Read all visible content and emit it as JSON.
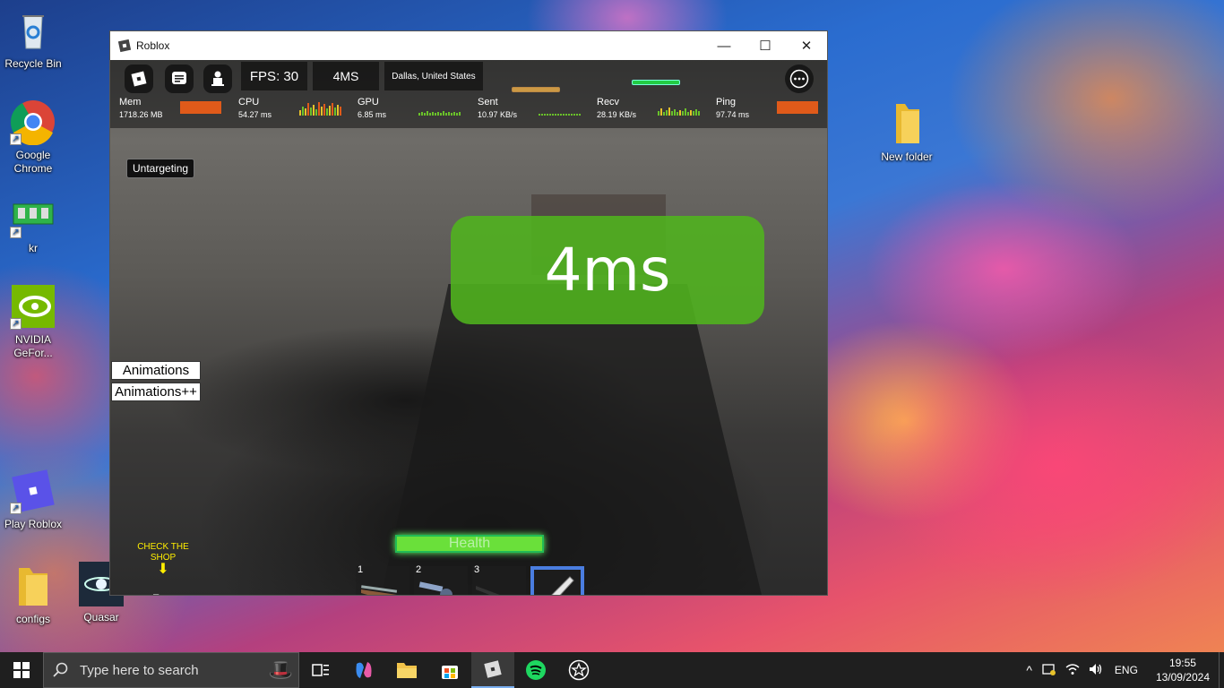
{
  "desktop": {
    "icons": [
      {
        "label": "Recycle Bin",
        "icon": "recycle-bin-icon"
      },
      {
        "label": "Google Chrome",
        "icon": "chrome-icon"
      },
      {
        "label": "kr",
        "icon": "memory-chip-icon"
      },
      {
        "label": "NVIDIA GeFor...",
        "icon": "nvidia-icon"
      },
      {
        "label": "Play Roblox",
        "icon": "roblox-icon"
      },
      {
        "label": "configs",
        "icon": "folder-icon"
      },
      {
        "label": "Quasar",
        "icon": "quasar-icon"
      },
      {
        "label": "New folder",
        "icon": "folder-icon"
      }
    ]
  },
  "window": {
    "title": "Roblox",
    "controls": {
      "minimize": "—",
      "maximize": "☐",
      "close": "✕"
    }
  },
  "game": {
    "fps": "FPS: 30",
    "ms": "4MS",
    "server": "Dallas, United States",
    "stats": {
      "mem": {
        "label": "Mem",
        "value": "1718.26 MB"
      },
      "cpu": {
        "label": "CPU",
        "value": "54.27 ms"
      },
      "gpu": {
        "label": "GPU",
        "value": "6.85 ms"
      },
      "sent": {
        "label": "Sent",
        "value": "10.97 KB/s"
      },
      "recv": {
        "label": "Recv",
        "value": "28.19 KB/s"
      },
      "ping": {
        "label": "Ping",
        "value": "97.74 ms"
      }
    },
    "untargeting": "Untargeting",
    "ping_display": "4ms",
    "animations_button": "Animations",
    "animations_plus_button": "Animations++",
    "health_label": "Health",
    "check_shop": "CHECK THE SHOP",
    "hotbar": [
      {
        "num": "1",
        "item": "shotgun-icon"
      },
      {
        "num": "2",
        "item": "revolver-icon"
      },
      {
        "num": "3",
        "item": "rifle-icon"
      },
      {
        "num": "",
        "item": "knife-icon",
        "selected": true
      }
    ]
  },
  "taskbar": {
    "search_placeholder": "Type here to search",
    "language": "ENG",
    "time": "19:55",
    "date": "13/09/2024"
  },
  "colors": {
    "ping_box": "#50b41e",
    "health": "#6ae03a",
    "hotbar_selected": "#4a7de0",
    "shop_text": "#ffee00"
  }
}
